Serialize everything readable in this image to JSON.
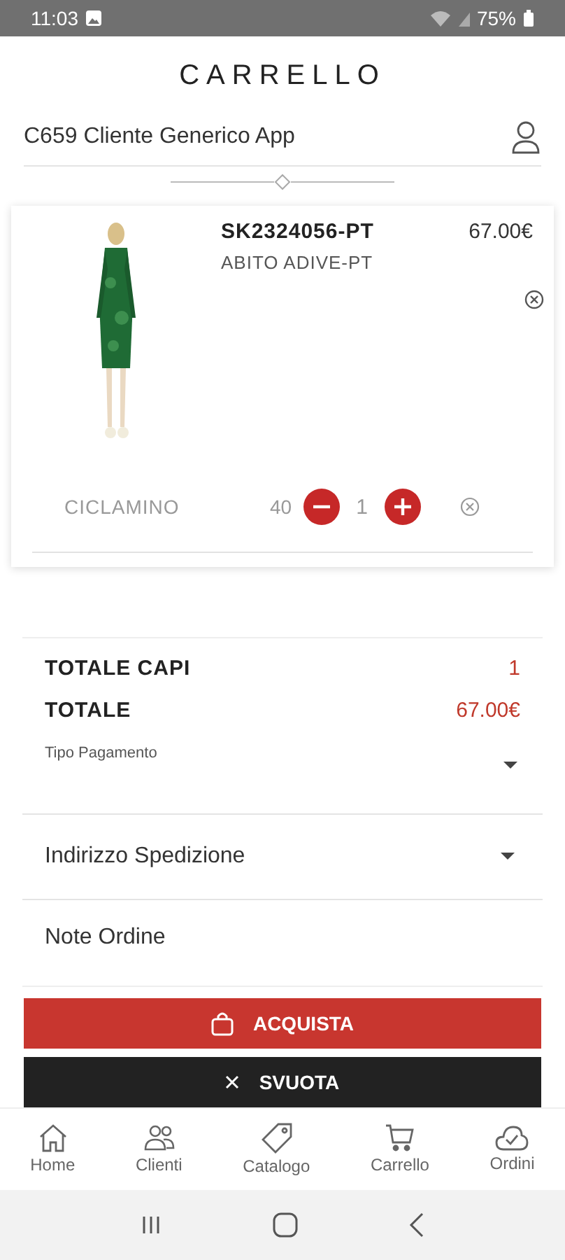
{
  "status_bar": {
    "time": "11:03",
    "battery": "75%"
  },
  "header": {
    "title": "CARRELLO"
  },
  "customer": {
    "name": "C659 Cliente Generico App"
  },
  "cart_items": [
    {
      "code": "SK2324056-PT",
      "price": "67.00€",
      "description": "ABITO ADIVE-PT",
      "variants": [
        {
          "color_name": "CICLAMINO",
          "size": "40",
          "quantity": "1"
        }
      ]
    }
  ],
  "totals": [
    {
      "label": "TOTALE CAPI",
      "value": "1"
    },
    {
      "label": "TOTALE",
      "value": "67.00€"
    }
  ],
  "payment": {
    "label": "Tipo Pagamento"
  },
  "shipping": {
    "placeholder": "Indirizzo Spedizione"
  },
  "notes": {
    "placeholder": "Note Ordine"
  },
  "buttons": [
    {
      "kind": "buy",
      "label": "ACQUISTA"
    },
    {
      "kind": "clear",
      "label": "SVUOTA"
    }
  ],
  "bottom_nav": [
    {
      "kind": "home",
      "label": "Home",
      "selected": false
    },
    {
      "kind": "clients",
      "label": "Clienti",
      "selected": false
    },
    {
      "kind": "catalog",
      "label": "Catalogo",
      "selected": false
    },
    {
      "kind": "cart",
      "label": "Carrello",
      "selected": false
    },
    {
      "kind": "orders",
      "label": "Ordini",
      "selected": false
    }
  ]
}
